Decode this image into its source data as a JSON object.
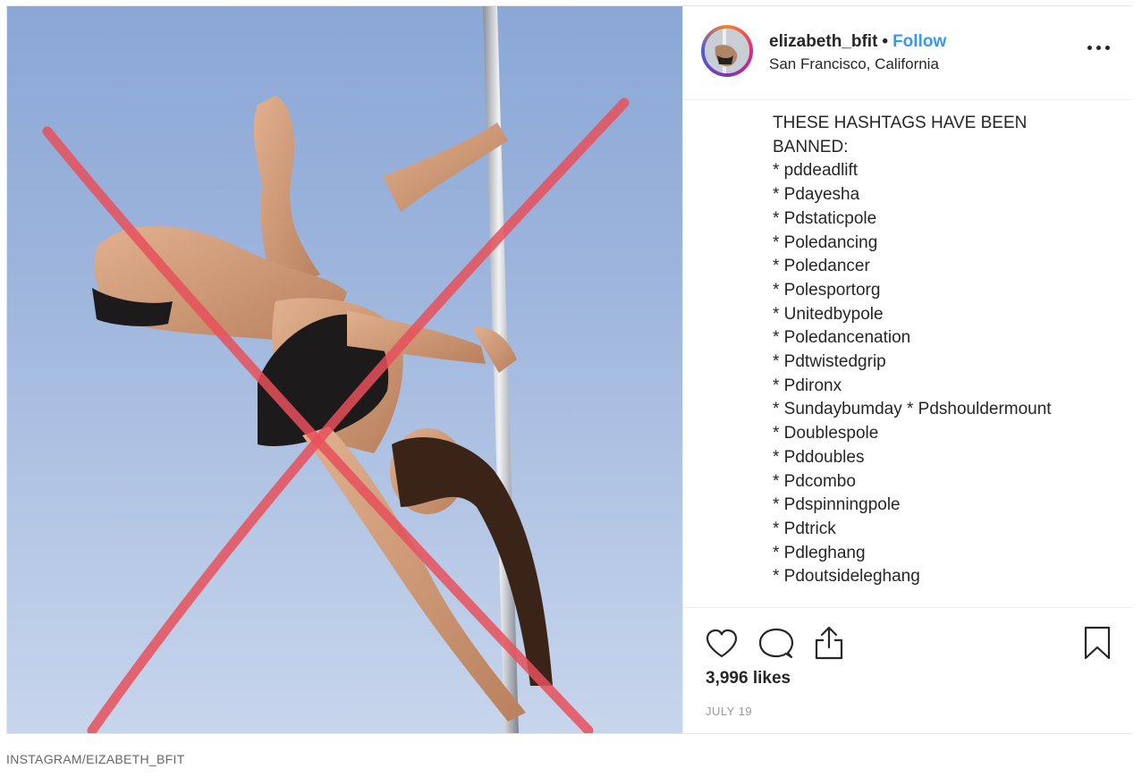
{
  "post": {
    "username": "elizabeth_bfit",
    "separator": "•",
    "follow_label": "Follow",
    "location": "San Francisco, California",
    "caption_lines": [
      "THESE HASHTAGS HAVE BEEN",
      "BANNED:",
      "* pddeadlift",
      "* Pdayesha",
      "* Pdstaticpole",
      "* Poledancing",
      "* Poledancer",
      "* Polesportorg",
      "* Unitedbypole",
      "* Poledancenation",
      "* Pdtwistedgrip",
      "* Pdironx",
      "* Sundaybumday * Pdshouldermount",
      "* Doublespole",
      "* Pddoubles",
      "* Pdcombo",
      "* Pdspinningpole",
      "* Pdtrick",
      "* Pdleghang",
      "* Pdoutsideleghang"
    ],
    "likes": "3,996 likes",
    "date": "JULY 19"
  },
  "icons": {
    "more": "more-options-icon",
    "like": "heart-icon",
    "comment": "comment-icon",
    "share": "share-icon",
    "save": "bookmark-icon"
  },
  "colors": {
    "follow": "#3897f0",
    "cross_mark": "#e8505b",
    "sky": "#9fb6dd"
  },
  "credit": "INSTAGRAM/EIZABETH_BFIT"
}
